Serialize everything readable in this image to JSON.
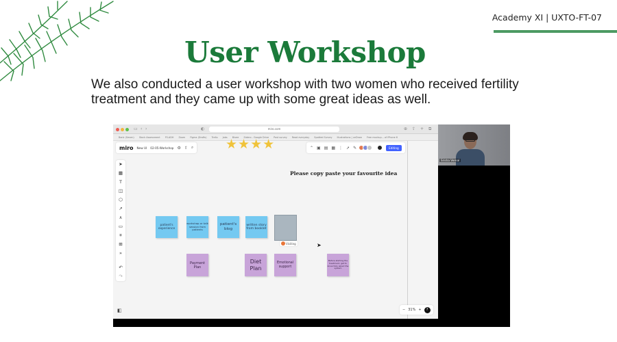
{
  "slide": {
    "course_tag": "Academy XI | UXTO-FT-07",
    "title": "User Workshop",
    "subtitle": "We also conducted a user workshop with two women who received fertility treatment and they came up with some great ideas as well."
  },
  "browser": {
    "url": "miro.com",
    "bookmarks": [
      "Bank (Seven)",
      "Stock Assessment",
      "FS-ADH",
      "Zoom",
      "Figma (Drafts)",
      "Trello",
      "Jobs",
      "Bluee",
      "Zotero - Google Drive",
      "Post survey",
      "Read everyday",
      "Spotted Survey",
      "Illustrations | unDraw",
      "Free mockup... of iPhone 6"
    ]
  },
  "miro": {
    "logo": "miro",
    "plan": "New UI",
    "board_name": "02-05-Workshop",
    "share_label": "Editing",
    "heading": "Please copy paste your favourite idea",
    "zoom": "31%",
    "visitor_label": "Visiting",
    "help": "?"
  },
  "stickies_blue": [
    "patient's experience",
    "workshop or talk session from patients",
    "patient's blog",
    "written story from booklet"
  ],
  "stickies_purple": [
    "Payment Plan",
    "Diet Plan",
    "Emotional support",
    "Before starting the treatment, get to know fully about the system"
  ],
  "webcam": {
    "participant_name": "Srisha Vemal"
  },
  "colors": {
    "title_green": "#1b7a3a",
    "rule_green": "#4c9a62",
    "sticky_blue": "#74c9f1",
    "sticky_purple": "#c8a4d9",
    "star": "#f0c33a"
  }
}
